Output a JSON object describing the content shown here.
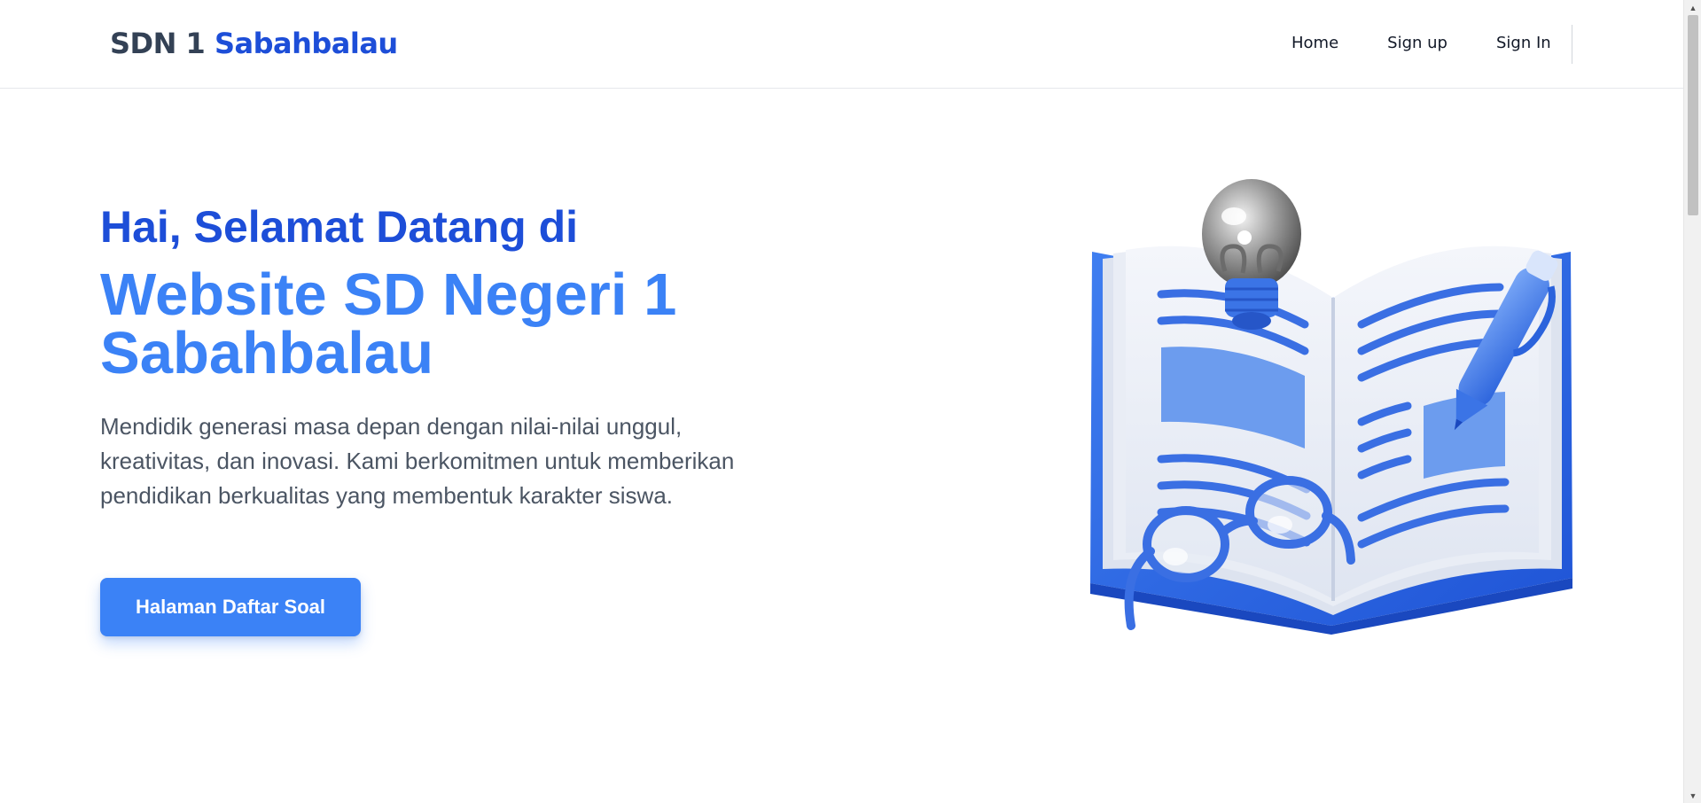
{
  "header": {
    "brand_part1": "SDN 1",
    "brand_part2": "Sabahbalau",
    "nav": {
      "home": "Home",
      "signup": "Sign up",
      "signin": "Sign In"
    }
  },
  "hero": {
    "greeting": "Hai, Selamat Datang di",
    "headline": "Website SD Negeri 1 Sabahbalau",
    "description": "Mendidik generasi masa depan dengan nilai-nilai unggul, kreativitas, dan inovasi. Kami berkomitmen untuk memberikan pendidikan berkualitas yang membentuk karakter siswa.",
    "cta_label": "Halaman Daftar Soal"
  },
  "illustration": {
    "icon": "open-book-lightbulb-pen-glasses-illustration"
  },
  "colors": {
    "brand_dark": "#334155",
    "brand_blue": "#1d4ed8",
    "accent": "#3b82f6",
    "text_muted": "#4b5563"
  }
}
